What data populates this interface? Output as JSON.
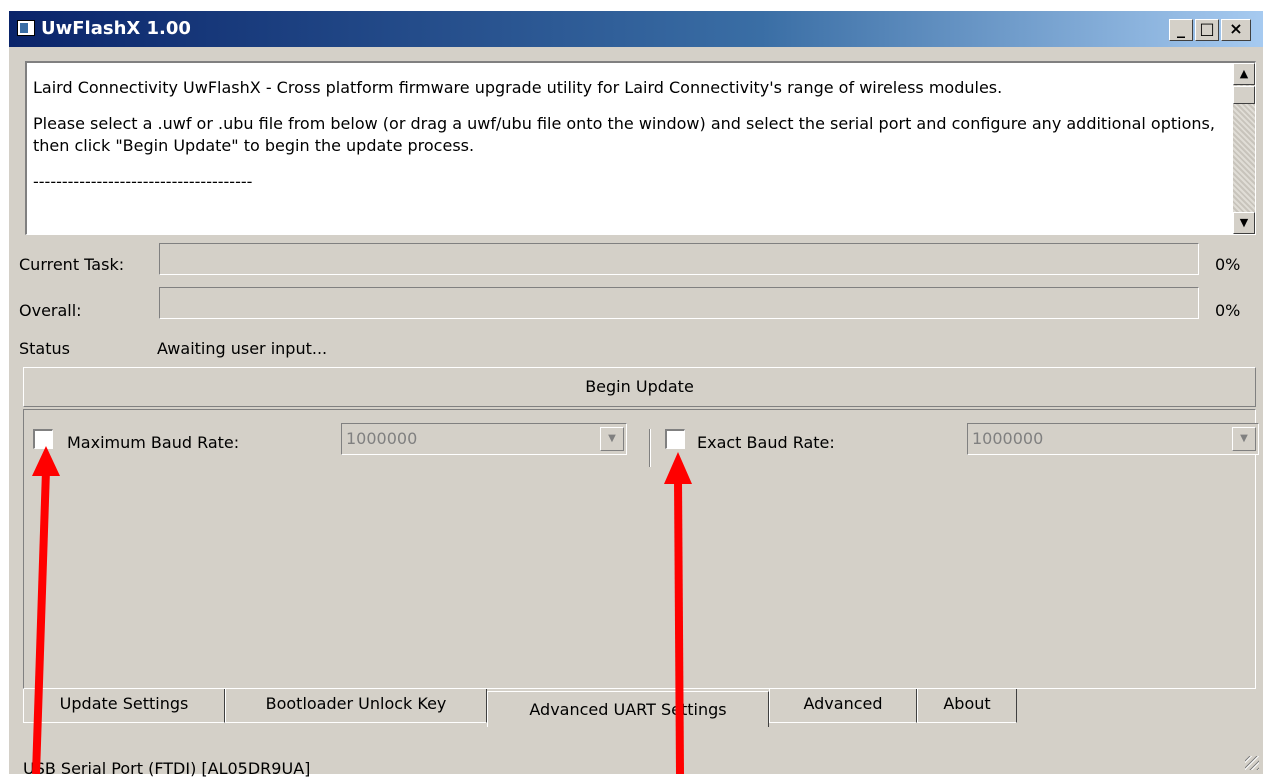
{
  "window": {
    "title": "UwFlashX 1.00",
    "minimize_glyph": "_",
    "maximize_glyph": "□",
    "close_glyph": "×"
  },
  "info": {
    "line1": "Laird Connectivity UwFlashX - Cross platform firmware upgrade utility for Laird Connectivity's range of wireless modules.",
    "line2": "Please select a .uwf or .ubu file from below (or drag a uwf/ubu file onto the window) and select the serial port and configure any additional options, then click \"Begin Update\" to begin the update process.",
    "line3": "--------------------------------------"
  },
  "progress": {
    "current_task_label": "Current Task:",
    "current_task_percent": "0%",
    "current_task_value": 0,
    "overall_label": "Overall:",
    "overall_percent": "0%",
    "overall_value": 0
  },
  "status": {
    "label": "Status",
    "text": "Awaiting user input..."
  },
  "begin_button": "Begin Update",
  "advanced_uart": {
    "max_baud": {
      "label": "Maximum Baud Rate:",
      "checked": false,
      "value": "1000000"
    },
    "exact_baud": {
      "label": "Exact Baud Rate:",
      "checked": false,
      "value": "1000000"
    }
  },
  "tabs": [
    {
      "label": "Update Settings",
      "active": false
    },
    {
      "label": "Bootloader Unlock Key",
      "active": false
    },
    {
      "label": "Advanced UART Settings",
      "active": true
    },
    {
      "label": "Advanced",
      "active": false
    },
    {
      "label": "About",
      "active": false
    }
  ],
  "statusbar": "USB Serial Port (FTDI) [AL05DR9UA]",
  "colors": {
    "annotation_arrow": "#ff0000",
    "title_bar": "#0a246a",
    "window_face": "#d4d0c8"
  }
}
